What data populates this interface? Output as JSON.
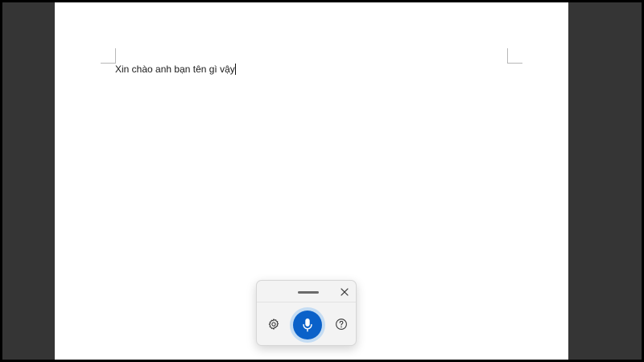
{
  "document": {
    "text": "Xin chào anh bạn tên gì vậy"
  },
  "voice_typing": {
    "icons": {
      "drag": "drag-handle-icon",
      "close": "close-icon",
      "settings": "gear-icon",
      "microphone": "microphone-icon",
      "help": "help-icon"
    },
    "state": "listening"
  },
  "colors": {
    "workspace_bg": "#353535",
    "page_bg": "#ffffff",
    "mic_accent": "#0a61c9",
    "mic_glow": "#c4dcf3",
    "panel_bg": "#f3f3f3"
  }
}
